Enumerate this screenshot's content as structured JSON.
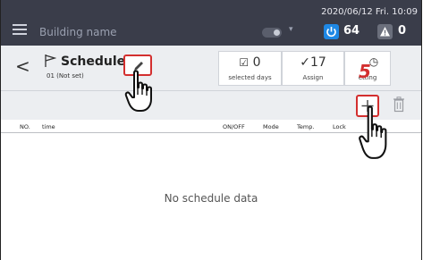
{
  "topbar": {
    "building_name": "Building name",
    "datetime": "2020/06/12 Fri. 10:09",
    "power_count": "64",
    "alarm_count": "0"
  },
  "header": {
    "title": "Schedule",
    "subtitle": "01  (Not set)",
    "stats": [
      {
        "value": "0",
        "label": "selected days"
      },
      {
        "value": "17",
        "label": "Assign"
      },
      {
        "value": "",
        "label": "etting"
      }
    ]
  },
  "step_number": "5",
  "table": {
    "columns": [
      "NO.",
      "time",
      "ON/OFF",
      "Mode",
      "Temp.",
      "Lock"
    ],
    "empty_message": "No schedule data"
  },
  "colors": {
    "topbar": "#3a3d4a",
    "header_bg": "#eceef1",
    "highlight": "#d32f2f",
    "power_blue": "#1e88e5"
  },
  "icons": [
    "menu-icon",
    "toggle-icon",
    "power-icon",
    "alarm-icon",
    "back-icon",
    "flag-icon",
    "pencil-icon",
    "calendar-check-icon",
    "check-icon",
    "timer-gear-icon",
    "plus-icon",
    "trash-icon",
    "pointing-hand-icon"
  ]
}
